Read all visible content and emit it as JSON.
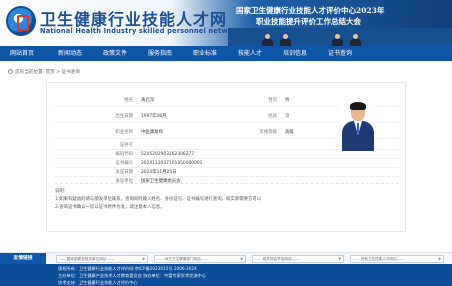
{
  "header": {
    "site_title": "卫生健康行业技能人才网",
    "site_subtitle": "National Health Industry skilled personnel network",
    "banner_line1": "国家卫生健康行业技能人才评价中心2023年",
    "banner_line2": "职业技能提升评价工作总结大会"
  },
  "nav": {
    "items": [
      "网站首页",
      "新闻动态",
      "政策文件",
      "服务指南",
      "职业标准",
      "技能人才",
      "培训信息",
      "证书查询"
    ]
  },
  "breadcrumb": "您的当前位置: 首页 > 证书查询",
  "certificate": {
    "name_label": "姓名",
    "name_value": "黄启深",
    "gender_label": "性别",
    "gender_value": "男",
    "birth_label": "出生日期",
    "birth_value": "1997年06月",
    "ethnicity_label": "民族",
    "ethnicity_value": "汉",
    "occupation_label": "职业名称",
    "occupation_value": "中医康复师",
    "level_label": "资格等级",
    "level_value": "高级",
    "id_label": "证件号",
    "cert_no_label": "编码代码",
    "cert_no_value": "5205292903262306277",
    "serial_label": "证书编号",
    "serial_value": "2024112037101350000001",
    "date_label": "发证日期",
    "date_value": "2024年11月25日",
    "org_label": "发证单位",
    "org_value": "国家卫生健康委员会"
  },
  "notes": {
    "title": "说明：",
    "line1": "1.如果有疑虑的请与颁发单位联系，查询同时输入姓名、身份证号、证书编号进行查询，如实际需要方可以",
    "line2": "2.查询证书确认一切以证书原件为准，请注意本人信息。"
  },
  "links": {
    "label": "友情链接",
    "selects": [
      "------国家部委及相关单位网站------",
      "------地方卫生健康部门网站------",
      "------相关协会学会网站------",
      "------其他卫生技能人才网站------"
    ]
  },
  "footer": {
    "line1": "版权所有：卫生健康行业技能人才评价网 京ICP备2023015号 2006-2024",
    "line2": "主办单位：卫生健康产业技术人才教育委员会 协办单位：中富专家学术交流中心",
    "line3": "技术支持：卫生健康行业技能人才评价中心"
  }
}
